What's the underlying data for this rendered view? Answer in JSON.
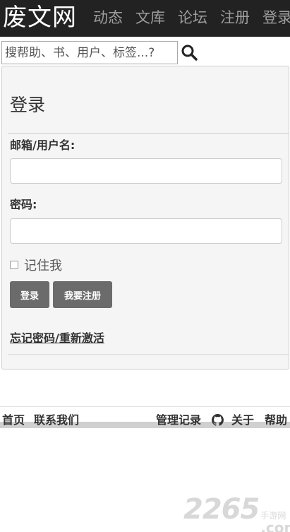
{
  "navbar": {
    "brand": "废文网",
    "items": [
      "动态",
      "文库",
      "论坛",
      "注册",
      "登录"
    ]
  },
  "search": {
    "placeholder": "搜帮助、书、用户、标签...?",
    "icon": "search-icon"
  },
  "login": {
    "title": "登录",
    "email_label": "邮箱/用户名:",
    "email_value": "",
    "password_label": "密码:",
    "password_value": "",
    "remember_label": "记住我",
    "remember_checked": false,
    "login_button": "登录",
    "register_button": "我要注册",
    "forgot_link": "忘记密码/重新激活"
  },
  "footer": {
    "home": "首页",
    "contact": "联系我们",
    "admin_log": "管理记录",
    "github_icon": "github-icon",
    "about": "关于",
    "help": "帮助"
  },
  "watermark": {
    "number": "2265",
    "top": "手游网",
    "bottom": ".com"
  },
  "colors": {
    "navbar_bg": "#222222",
    "nav_text": "#9d9d9d",
    "panel_bg": "#f5f5f5",
    "button_bg": "#6b6b6b"
  }
}
